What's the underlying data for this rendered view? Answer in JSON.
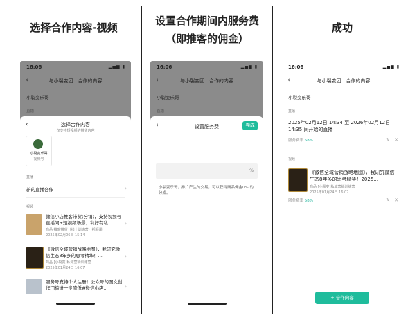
{
  "columns": [
    {
      "title_line1": "选择合作内容-视频",
      "title_line2": ""
    },
    {
      "title_line1": "设置合作期间内服务费",
      "title_line2": "（即推客的佣金）"
    },
    {
      "title_line1": "成功",
      "title_line2": ""
    }
  ],
  "phone1": {
    "status_time": "16:06",
    "nav_title": "与小裂变团...合作的内容",
    "shop_name": "小裂变乐哥",
    "dim_label": "直播",
    "sheet_title": "选择合作内容",
    "sheet_subtitle": "仅支持短视频的带货内容",
    "account_name": "小裂变乐哥",
    "account_sub": "视频号",
    "section_live": "直播",
    "new_live": "新的直播合作",
    "section_video": "视频",
    "videos": [
      {
        "title": "微信小店推客带货(分销)，支持视频号直播间+短视频场景，利好有私...",
        "meta": "商品 推客带货（线上训练营）视频课",
        "date": "2025年02月06日 15:14"
      },
      {
        "title": "《微信全域营销战略地图》，我研究微信生态8年多的思考精华！...",
        "meta": "商品 [小裂变]私域营销训练营",
        "date": "2025年01月24日 16:07"
      },
      {
        "title": "服务号支持个人注册！公众号的图文创作门槛进一步降低#微信小店...",
        "meta": "",
        "date": ""
      }
    ]
  },
  "phone2": {
    "status_time": "16:06",
    "nav_title": "与小裂变团...合作的内容",
    "shop_name": "小裂变乐哥",
    "dim_label": "直播",
    "sheet_title": "设置服务费",
    "confirm": "完成",
    "input_unit": "%",
    "hint": "小裂变乐哥，推广产生的交易，可以获得商品佣金0% 的分成。"
  },
  "phone3": {
    "status_time": "16:06",
    "nav_title": "与小裂变团...合作的内容",
    "shop_name": "小裂变乐哥",
    "section_live": "直播",
    "live_text": "2025年02月12日 14:34 至 2026年02月12日 14:35 间开始的直播",
    "fee_label": "服务费率",
    "fee_value": "58%",
    "section_video": "视频",
    "video_title": "《微信全域营销战略地图》，我研究微信生态8年多的思考精华！2025...",
    "video_meta": "商品 [小裂变]私域营销训练营",
    "video_date": "2025年01月24日 16:07",
    "fee_label2": "服务费率",
    "fee_value2": "58%",
    "add_button": "+ 合作内容"
  }
}
